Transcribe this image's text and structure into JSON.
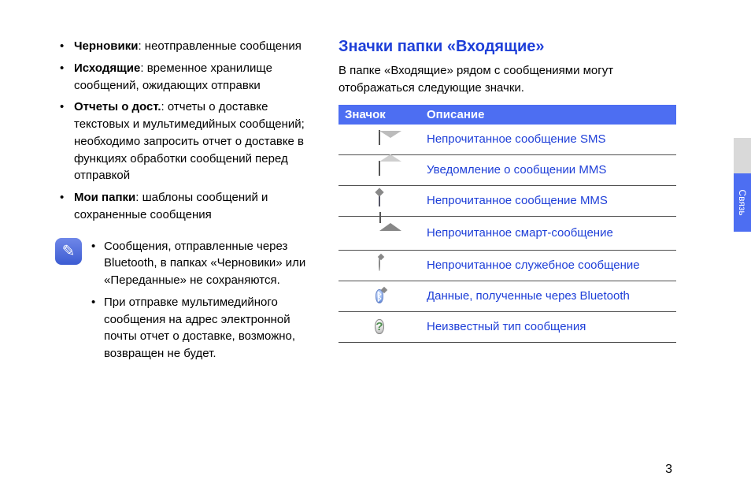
{
  "tab_label": "Связь",
  "page_number": "3",
  "left": {
    "items": [
      {
        "term": "Черновики",
        "rest": ": неотправленные сообщения"
      },
      {
        "term": "Исходящие",
        "rest": ": временное хранилище сообщений, ожидающих отправки"
      },
      {
        "term": "Отчеты о дост.",
        "rest": ": отчеты о доставке текстовых и мультимедийных сообщений; необходимо запросить отчет о доставке в функциях обработки сообщений перед отправкой"
      },
      {
        "term": "Мои папки",
        "rest": ": шаблоны сообщений и сохраненные сообщения"
      }
    ],
    "note": [
      "Сообщения, отправленные через Bluetooth, в папках «Черновики» или «Переданные» не сохраняются.",
      "При отправке мультимедийного сообщения на адрес электронной почты отчет о доставке, возможно, возвращен не будет."
    ]
  },
  "right": {
    "title": "Значки папки «Входящие»",
    "intro": "В папке «Входящие» рядом с сообщениями могут отображаться следующие значки.",
    "headers": {
      "icon": "Значок",
      "desc": "Описание"
    },
    "rows": [
      {
        "icon": "sms-unread",
        "desc": "Непрочитанное сообщение SMS"
      },
      {
        "icon": "mms-notify",
        "desc": "Уведомление о сообщении MMS"
      },
      {
        "icon": "mms-unread",
        "desc": "Непрочитанное сообщение MMS"
      },
      {
        "icon": "smart-unread",
        "desc": "Непрочитанное смарт-сообщение"
      },
      {
        "icon": "service-unread",
        "desc": "Непрочитанное служебное сообщение"
      },
      {
        "icon": "bluetooth-data",
        "desc": "Данные, полученные через Bluetooth"
      },
      {
        "icon": "unknown-type",
        "desc": "Неизвестный тип сообщения"
      }
    ]
  }
}
